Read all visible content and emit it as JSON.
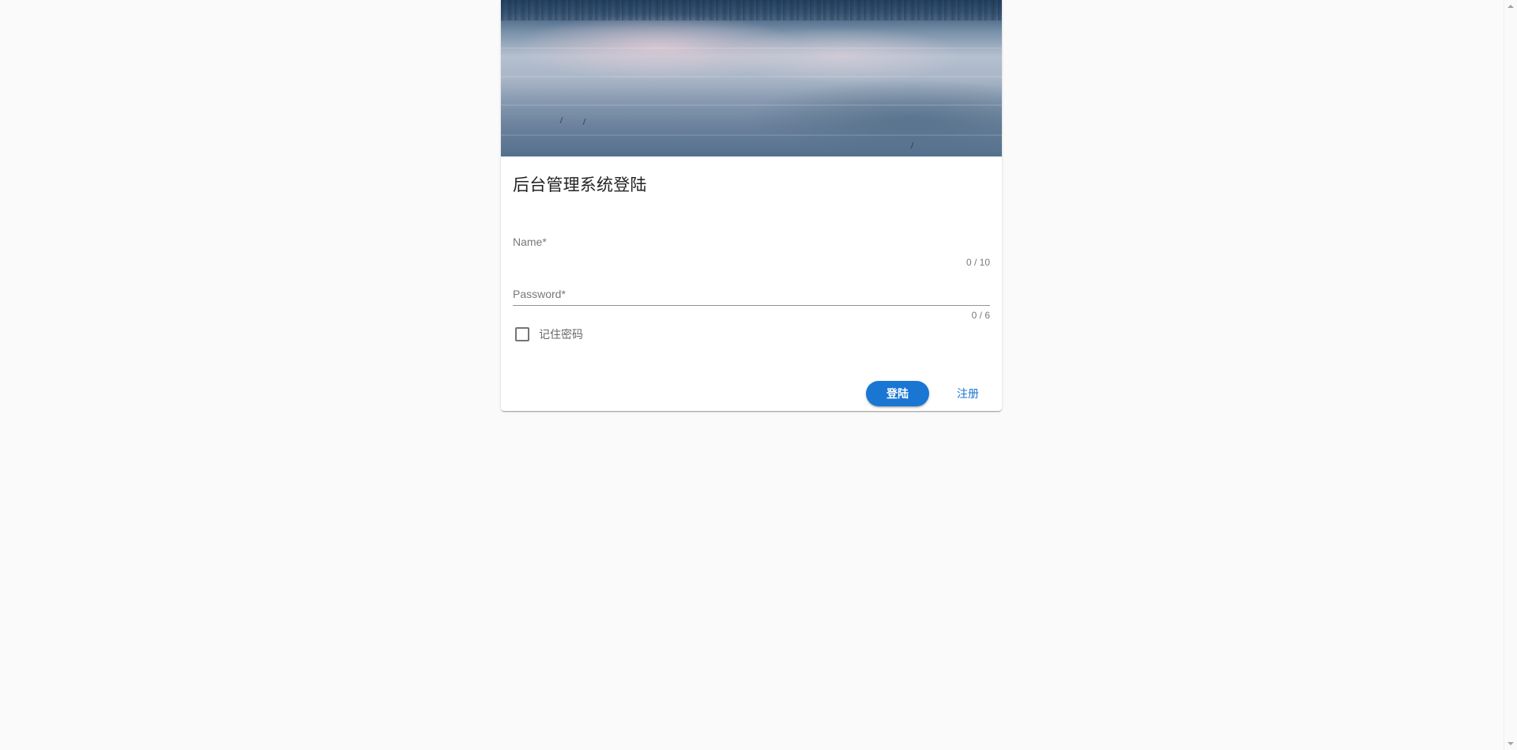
{
  "card": {
    "title": "后台管理系统登陆"
  },
  "form": {
    "name": {
      "label": "Name*",
      "value": "",
      "counter": "0 / 10"
    },
    "password": {
      "label": "Password*",
      "value": "",
      "counter": "0 / 6"
    },
    "remember": {
      "label": "记住密码",
      "checked": false
    }
  },
  "actions": {
    "login_label": "登陆",
    "register_label": "注册"
  },
  "colors": {
    "primary": "#1976d2",
    "background": "#fafafa",
    "card": "#ffffff"
  }
}
